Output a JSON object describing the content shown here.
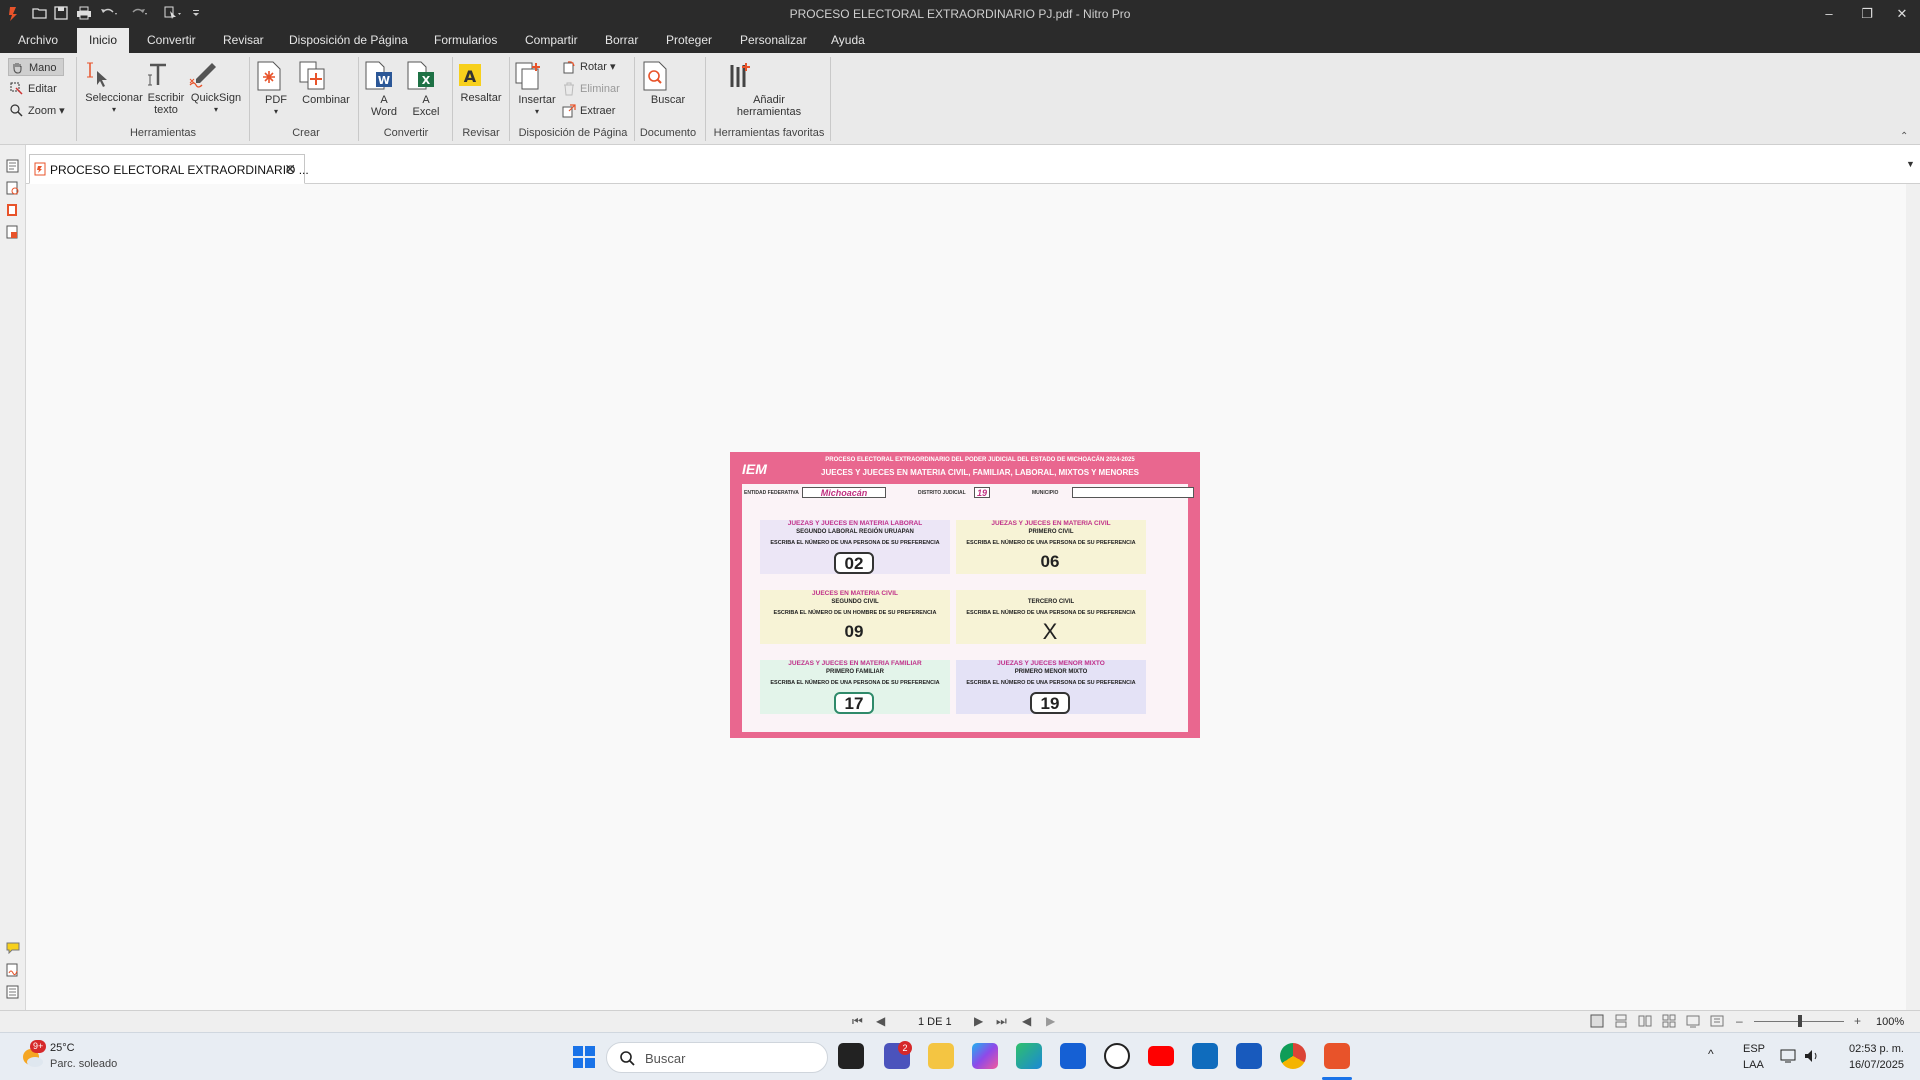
{
  "window": {
    "title": "PROCESO ELECTORAL EXTRAORDINARIO PJ.pdf - Nitro Pro",
    "controls": {
      "minimize": "–",
      "restore": "❐",
      "close": "✕"
    }
  },
  "menu": {
    "tabs": [
      "Archivo",
      "Inicio",
      "Convertir",
      "Revisar",
      "Disposición de Página",
      "Formularios",
      "Compartir",
      "Borrar",
      "Proteger",
      "Personalizar",
      "Ayuda"
    ],
    "active": "Inicio"
  },
  "ribbon": {
    "mode_tools": {
      "mano": "Mano",
      "editar": "Editar",
      "zoom": "Zoom"
    },
    "herramientas": {
      "seleccionar": "Seleccionar",
      "escribir_1": "Escribir",
      "escribir_2": "texto",
      "quicksign": "QuickSign",
      "group": "Herramientas"
    },
    "crear": {
      "pdf": "PDF",
      "combinar": "Combinar",
      "group": "Crear"
    },
    "convertir": {
      "a": "A",
      "word": "Word",
      "excel": "Excel",
      "group": "Convertir"
    },
    "revisar": {
      "resaltar": "Resaltar",
      "group": "Revisar"
    },
    "disposicion": {
      "insertar": "Insertar",
      "rotar": "Rotar",
      "eliminar": "Eliminar",
      "extraer": "Extraer",
      "group": "Disposición de Página"
    },
    "documento": {
      "buscar": "Buscar",
      "group": "Documento"
    },
    "favoritas": {
      "anadir_1": "Añadir",
      "anadir_2": "herramientas",
      "group": "Herramientas favoritas"
    }
  },
  "doc_tab": {
    "label": "PROCESO ELECTORAL EXTRAORDINARIO ...",
    "close": "✕"
  },
  "ballot": {
    "logo": "IEM",
    "title_line1": "PROCESO ELECTORAL EXTRAORDINARIO DEL PODER JUDICIAL DEL ESTADO DE MICHOACÁN 2024-2025",
    "title_line2": "JUECES Y JUECES EN MATERIA CIVIL, FAMILIAR, LABORAL, MIXTOS Y MENORES",
    "entidad_label": "ENTIDAD FEDERATIVA",
    "entidad_value": "Michoacán",
    "distrito_label": "DISTRITO JUDICIAL",
    "distrito_value": "19",
    "municipio_label": "MUNICIPIO",
    "sections": [
      {
        "h1": "JUEZAS Y JUECES EN MATERIA LABORAL",
        "h2": "SEGUNDO LABORAL REGIÓN URUAPAN",
        "h3": "ESCRIBA EL NÚMERO DE UNA PERSONA DE SU PREFERENCIA",
        "value": "02"
      },
      {
        "h1": "JUEZAS Y JUECES EN MATERIA CIVIL",
        "h2": "PRIMERO CIVIL",
        "h3": "ESCRIBA EL NÚMERO DE UNA PERSONA DE SU PREFERENCIA",
        "value": "06"
      },
      {
        "h1": "JUECES EN MATERIA CIVIL",
        "h2": "SEGUNDO CIVIL",
        "h3": "ESCRIBA EL NÚMERO DE UN HOMBRE DE SU PREFERENCIA",
        "value": "09"
      },
      {
        "h1": "",
        "h2": "TERCERO CIVIL",
        "h3": "ESCRIBA EL NÚMERO DE UNA PERSONA DE SU PREFERENCIA",
        "value": "X"
      },
      {
        "h1": "JUEZAS Y JUECES EN MATERIA FAMILIAR",
        "h2": "PRIMERO FAMILIAR",
        "h3": "ESCRIBA EL NÚMERO DE UNA PERSONA DE SU PREFERENCIA",
        "value": "17"
      },
      {
        "h1": "JUEZAS Y JUECES MENOR MIXTO",
        "h2": "PRIMERO MENOR MIXTO",
        "h3": "ESCRIBA EL NÚMERO DE UNA PERSONA DE SU PREFERENCIA",
        "value": "19"
      }
    ]
  },
  "statusbar": {
    "page_indicator": "1 DE 1",
    "zoom": "100%",
    "minus": "–",
    "plus": "+"
  },
  "taskbar": {
    "weather_temp": "25°C",
    "weather_desc": "Parc. soleado",
    "weather_badge": "9+",
    "search_placeholder": "Buscar",
    "teams_badge": "2",
    "lang_1": "ESP",
    "lang_2": "LAA",
    "time": "02:53 p. m.",
    "date": "16/07/2025"
  },
  "colors": {
    "accent": "#e8532a",
    "ballot_border": "#e9678f",
    "ballot_header": "#c0308a"
  }
}
